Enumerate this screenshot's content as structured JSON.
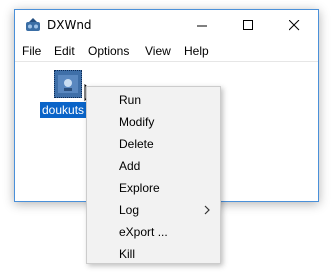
{
  "window": {
    "title": "DXWnd"
  },
  "menubar": {
    "items": [
      "File",
      "Edit",
      "Options",
      "View",
      "Help"
    ]
  },
  "app_list": {
    "items": [
      {
        "label": "doukuts",
        "selected": true
      }
    ]
  },
  "context_menu": {
    "items": [
      {
        "label": "Run"
      },
      {
        "label": "Modify"
      },
      {
        "label": "Delete"
      },
      {
        "label": "Add"
      },
      {
        "label": "Explore"
      },
      {
        "label": "Log",
        "submenu": true
      },
      {
        "label": "eXport ..."
      },
      {
        "label": "Kill"
      }
    ]
  },
  "colors": {
    "selection": "#0a64c8",
    "window_border": "#4a90d9",
    "menu_bg": "#f2f2f2"
  }
}
